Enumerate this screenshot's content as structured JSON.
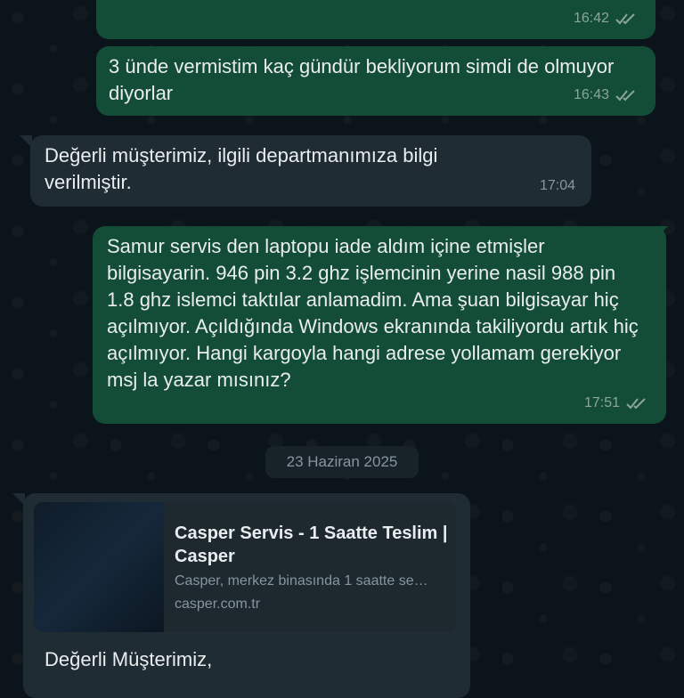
{
  "messages": [
    {
      "direction": "out",
      "text": "",
      "time": "16:42",
      "status": "read"
    },
    {
      "direction": "out",
      "text": "3 ünde vermistim kaç gündür bekliyorum simdi de olmuyor diyorlar",
      "time": "16:43",
      "status": "read"
    },
    {
      "direction": "in",
      "text": "Değerli müşterimiz, ilgili departmanımıza bilgi verilmiştir.",
      "time": "17:04"
    },
    {
      "direction": "out",
      "text": "Samur servis den laptopu iade aldım içine etmişler bilgisayarin. 946 pin 3.2 ghz işlemcinin yerine nasil 988 pin 1.8 ghz islemci taktılar anlamadim. Ama şuan bilgisayar hiç açılmıyor. Açıldığında Windows ekranında takiliyordu artık hiç açılmıyor. Hangi kargoyla hangi adrese yollamam gerekiyor msj la yazar mısınız?",
      "time": "17:51",
      "status": "read"
    }
  ],
  "date_separator": "23 Haziran 2025",
  "link_preview": {
    "title": "Casper Servis - 1 Saatte Teslim | Casper",
    "description": "Casper, merkez binasında 1 saatte se…",
    "domain": "casper.com.tr"
  },
  "incoming_partial": {
    "text": "Değerli Müşterimiz,"
  },
  "colors": {
    "outgoing_bubble": "#144d37",
    "incoming_bubble": "#202c33",
    "background": "#0b141a",
    "read_ticks": "#8aa69a"
  },
  "icons": {
    "read_receipt": "double-check-icon"
  }
}
